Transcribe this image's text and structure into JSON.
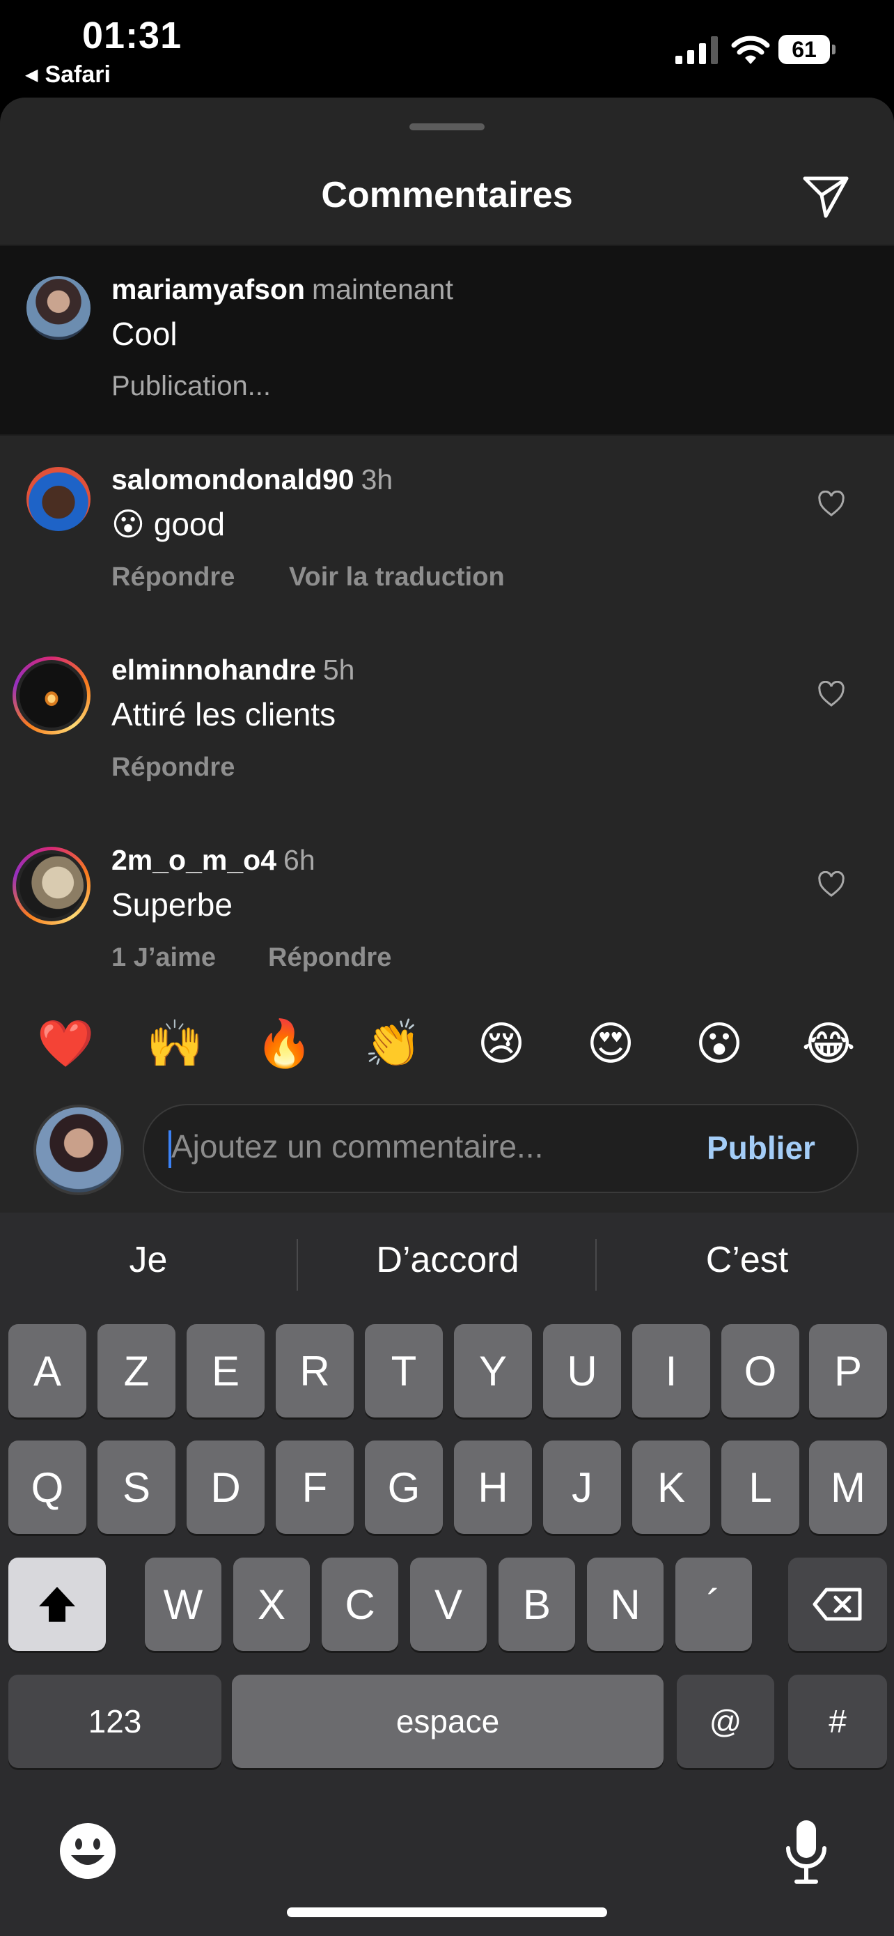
{
  "status_bar": {
    "time": "01:31",
    "back_app": "Safari",
    "battery": "61"
  },
  "header": {
    "title": "Commentaires",
    "send_icon": "send-icon"
  },
  "pending_comment": {
    "username": "mariamyafson",
    "time": "maintenant",
    "text": "Cool",
    "status": "Publication..."
  },
  "comments": [
    {
      "username": "salomondonald90",
      "time": "3h",
      "emoji": "😮",
      "text": "good",
      "actions": [
        "Répondre",
        "Voir la traduction"
      ]
    },
    {
      "username": "elminnohandre",
      "time": "5h",
      "text": "Attiré les clients",
      "actions": [
        "Répondre"
      ]
    },
    {
      "username": "2m_o_m_o4",
      "time": "6h",
      "text": "Superbe",
      "actions": [
        "1 J’aime",
        "Répondre"
      ]
    }
  ],
  "emoji_bar": [
    "❤️",
    "🙌",
    "🔥",
    "👏",
    "😢",
    "😍",
    "😮",
    "😂"
  ],
  "input": {
    "placeholder": "Ajoutez un commentaire...",
    "publish_label": "Publier"
  },
  "keyboard": {
    "suggestions": [
      "Je",
      "D’accord",
      "C’est"
    ],
    "row1": [
      "A",
      "Z",
      "E",
      "R",
      "T",
      "Y",
      "U",
      "I",
      "O",
      "P"
    ],
    "row2": [
      "Q",
      "S",
      "D",
      "F",
      "G",
      "H",
      "J",
      "K",
      "L",
      "M"
    ],
    "row3": [
      "W",
      "X",
      "C",
      "V",
      "B",
      "N",
      "´"
    ],
    "numbers_label": "123",
    "space_label": "espace",
    "at_label": "@",
    "hash_label": "#"
  },
  "colors": {
    "accent": "#a4cdf7",
    "background": "#262626",
    "keyboard": "#2c2c2e"
  }
}
